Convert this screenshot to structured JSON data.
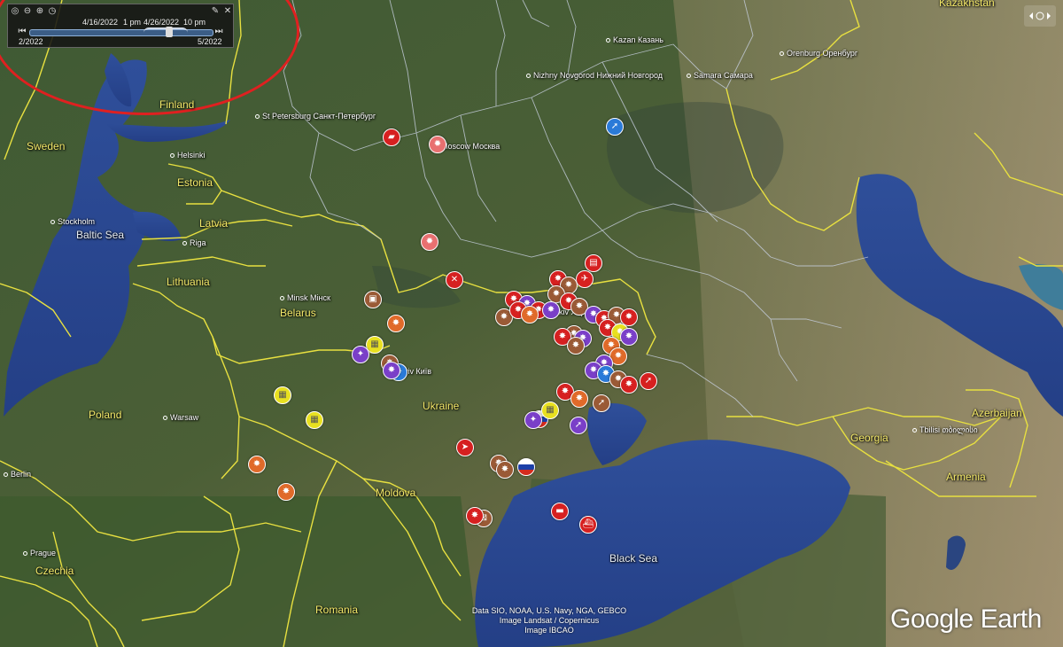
{
  "toolbar": {
    "date_left": "4/16/2022",
    "time_left": "1 pm",
    "date_right": "4/26/2022",
    "time_right": "10 pm",
    "range_start": "2/2022",
    "range_end": "5/2022",
    "slider_position": 0.76
  },
  "countries": [
    {
      "id": "finland",
      "label": "Finland"
    },
    {
      "id": "sweden",
      "label": "Sweden"
    },
    {
      "id": "estonia",
      "label": "Estonia"
    },
    {
      "id": "latvia",
      "label": "Latvia"
    },
    {
      "id": "lithuania",
      "label": "Lithuania"
    },
    {
      "id": "belarus",
      "label": "Belarus"
    },
    {
      "id": "poland",
      "label": "Poland"
    },
    {
      "id": "ukraine",
      "label": "Ukraine"
    },
    {
      "id": "moldova",
      "label": "Moldova"
    },
    {
      "id": "romania",
      "label": "Romania"
    },
    {
      "id": "czechia",
      "label": "Czechia"
    },
    {
      "id": "georgia",
      "label": "Georgia"
    },
    {
      "id": "armenia",
      "label": "Armenia"
    },
    {
      "id": "azerbaijan",
      "label": "Azerbaijan"
    },
    {
      "id": "kazakhstan",
      "label": "Kazakhstan"
    }
  ],
  "cities": [
    {
      "id": "st-petersburg",
      "label": "St Petersburg Санкт-Петербург"
    },
    {
      "id": "moscow",
      "label": "Moscow Москва"
    },
    {
      "id": "kazan",
      "label": "Kazan Казань"
    },
    {
      "id": "nizhny",
      "label": "Nizhny Novgorod Нижний Новгород"
    },
    {
      "id": "samara",
      "label": "Samara Самара"
    },
    {
      "id": "orenburg",
      "label": "Orenburg Оренбург"
    },
    {
      "id": "helsinki",
      "label": "Helsinki"
    },
    {
      "id": "stockholm",
      "label": "Stockholm"
    },
    {
      "id": "riga",
      "label": "Riga"
    },
    {
      "id": "minsk",
      "label": "Minsk Мінск"
    },
    {
      "id": "kyiv",
      "label": "Kyiv Київ"
    },
    {
      "id": "kharkiv",
      "label": "Kharkiv Харків"
    },
    {
      "id": "warsaw",
      "label": "Warsaw"
    },
    {
      "id": "berlin",
      "label": "Berlin"
    },
    {
      "id": "prague",
      "label": "Prague"
    },
    {
      "id": "tbilisi",
      "label": "Tbilisi თბილისი"
    }
  ],
  "seas": [
    {
      "id": "baltic",
      "label": "Baltic Sea"
    },
    {
      "id": "black",
      "label": "Black Sea"
    }
  ],
  "credits": [
    "Data SIO, NOAA, U.S. Navy, NGA, GEBCO",
    "Image Landsat / Copernicus",
    "Image IBCAO"
  ],
  "brand": "Google Earth",
  "colors": {
    "explosion": "#e06a2a",
    "attack": "#d62020",
    "purple": "#7a3fc8",
    "yellow": "#e8e020",
    "brown": "#9a5a36",
    "blue": "#2a7ad8",
    "border": "#e8e040",
    "annotation": "#e02020"
  },
  "markers": [
    {
      "type": "brown",
      "icon": "explosion-icon"
    },
    {
      "type": "attack",
      "icon": "truck-icon"
    },
    {
      "type": "pink",
      "icon": "fire-icon"
    },
    {
      "type": "blue",
      "icon": "running-icon"
    },
    {
      "type": "pink",
      "icon": "fire-icon"
    },
    {
      "type": "attack",
      "icon": "cross-icon"
    },
    {
      "type": "brown",
      "icon": "vehicle-icon"
    },
    {
      "type": "explosion",
      "icon": "explosion-icon"
    },
    {
      "type": "yellow",
      "icon": "building-icon"
    },
    {
      "type": "purple",
      "icon": "star-icon"
    },
    {
      "type": "yellow",
      "icon": "building-icon"
    },
    {
      "type": "yellow",
      "icon": "building-icon"
    },
    {
      "type": "explosion",
      "icon": "explosion-icon"
    },
    {
      "type": "explosion",
      "icon": "explosion-icon"
    },
    {
      "type": "attack",
      "icon": "rocket-icon"
    },
    {
      "type": "brown",
      "icon": "explosion-icon"
    },
    {
      "type": "flag",
      "icon": "russia-flag-icon"
    },
    {
      "type": "attack",
      "icon": "tank-icon"
    },
    {
      "type": "brown",
      "icon": "barrier-icon"
    },
    {
      "type": "attack",
      "icon": "ship-icon"
    },
    {
      "type": "brown",
      "icon": "running-icon"
    },
    {
      "type": "flag",
      "icon": "russia-flag-icon"
    },
    {
      "type": "attack",
      "icon": "running-icon"
    },
    {
      "type": "purple",
      "icon": "star-icon"
    },
    {
      "type": "yellow",
      "icon": "building-icon"
    },
    {
      "type": "purple",
      "icon": "running-icon"
    },
    {
      "type": "brown",
      "icon": "explosion-icon"
    },
    {
      "type": "attack",
      "icon": "train-icon"
    },
    {
      "type": "attack",
      "icon": "helicopter-icon"
    }
  ]
}
